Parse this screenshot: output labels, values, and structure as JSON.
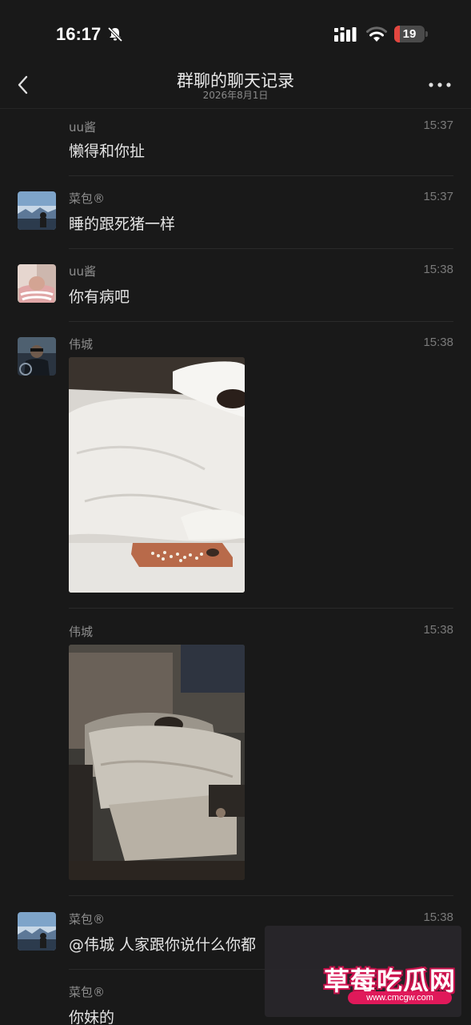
{
  "status_bar": {
    "time": "16:17",
    "battery": "19",
    "battery_level": 0.19,
    "icons": [
      "bell-muted-icon",
      "cellular-signal-icon",
      "wifi-icon",
      "battery-icon"
    ]
  },
  "nav": {
    "title": "群聊的聊天记录",
    "subtitle": "2026年8月1日",
    "back_icon": "chevron-left-icon",
    "more_icon": "more-dots-icon"
  },
  "messages": [
    {
      "sender": "uu酱",
      "time": "15:37",
      "text": "懒得和你扯",
      "avatar": "none"
    },
    {
      "sender": "菜包®",
      "time": "15:37",
      "text": "睡的跟死猪一样",
      "avatar": "avatar-landscape"
    },
    {
      "sender": "uu酱",
      "time": "15:38",
      "text": "你有病吧",
      "avatar": "avatar-girl"
    },
    {
      "sender": "伟城",
      "time": "15:38",
      "text": "",
      "image": "photo-bed-closeup",
      "avatar": "avatar-car"
    },
    {
      "sender": "伟城",
      "time": "15:38",
      "text": "",
      "image": "photo-hotel-room",
      "avatar": "none"
    },
    {
      "sender": "菜包®",
      "time": "15:38",
      "text": "@伟城 人家跟你说什么你都",
      "avatar": "avatar-landscape"
    },
    {
      "sender": "菜包®",
      "time": "",
      "text": "你妹的",
      "avatar": "none"
    }
  ],
  "watermark": {
    "title": "草莓吃瓜网",
    "url": "www.cmcgw.com"
  },
  "colors": {
    "background": "#191919",
    "battery_low": "#e2463f",
    "watermark_accent": "#e0195a"
  }
}
